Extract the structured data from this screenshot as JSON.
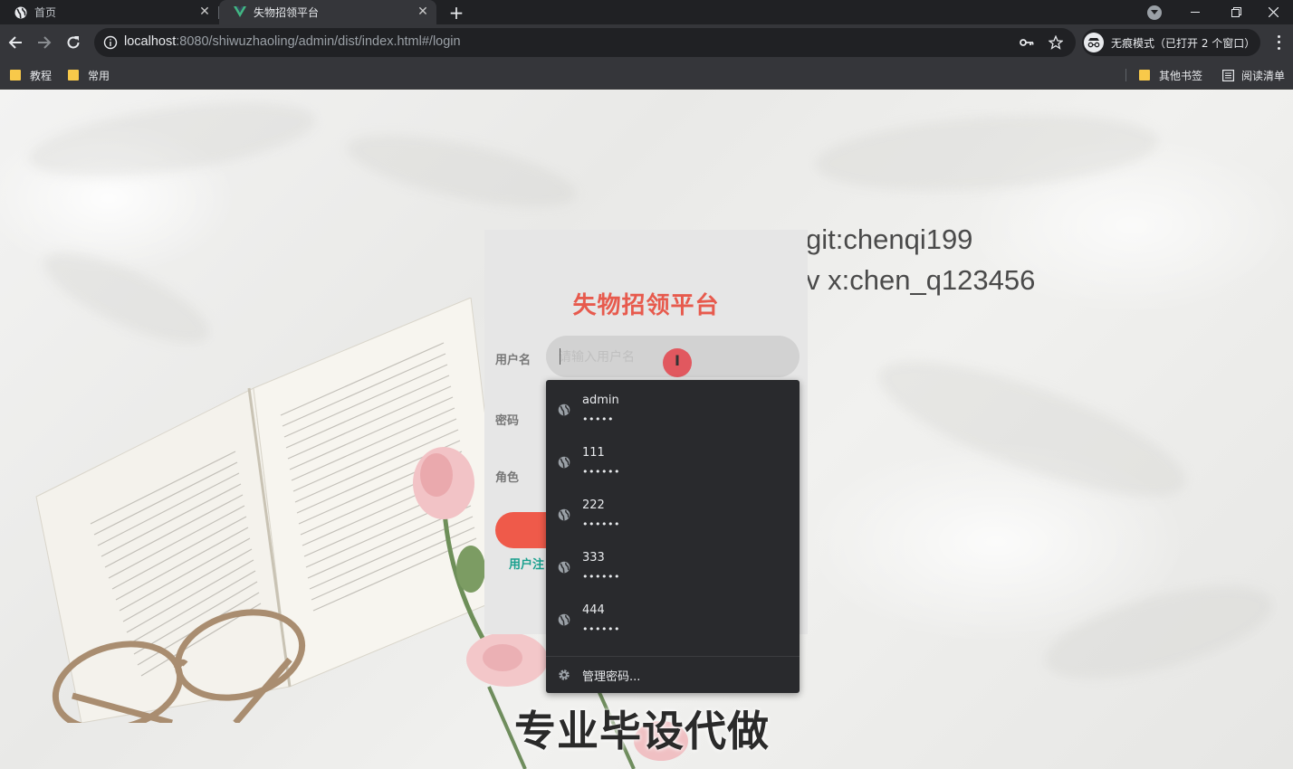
{
  "browser": {
    "tabs": [
      {
        "title": "首页",
        "active": false
      },
      {
        "title": "失物招领平台",
        "active": true
      }
    ],
    "address": {
      "host": "localhost",
      "path": ":8080/shiwuzhaoling/admin/dist/index.html#/login"
    },
    "incognito_label": "无痕模式（已打开 2 个窗口）",
    "bookmarks": [
      "教程",
      "常用"
    ],
    "bookmarks_right": [
      "其他书签",
      "阅读清单"
    ]
  },
  "watermark": {
    "line1": "git:chenqi199",
    "line2": "v x:chen_q123456"
  },
  "login": {
    "title": "失物招领平台",
    "username_label": "用户名",
    "username_placeholder": "请输入用户名",
    "password_label": "密码",
    "role_label": "角色",
    "register_link": "用户注"
  },
  "autofill": {
    "items": [
      {
        "username": "admin",
        "password": "•••••"
      },
      {
        "username": "111",
        "password": "••••••"
      },
      {
        "username": "222",
        "password": "••••••"
      },
      {
        "username": "333",
        "password": "••••••"
      },
      {
        "username": "444",
        "password": "••••••"
      }
    ],
    "manage_label": "管理密码..."
  },
  "overlay_caption": "专业毕设代做",
  "colors": {
    "accent": "#e75a4d",
    "link": "#19a08e",
    "dropdown_bg": "#292a2d"
  }
}
